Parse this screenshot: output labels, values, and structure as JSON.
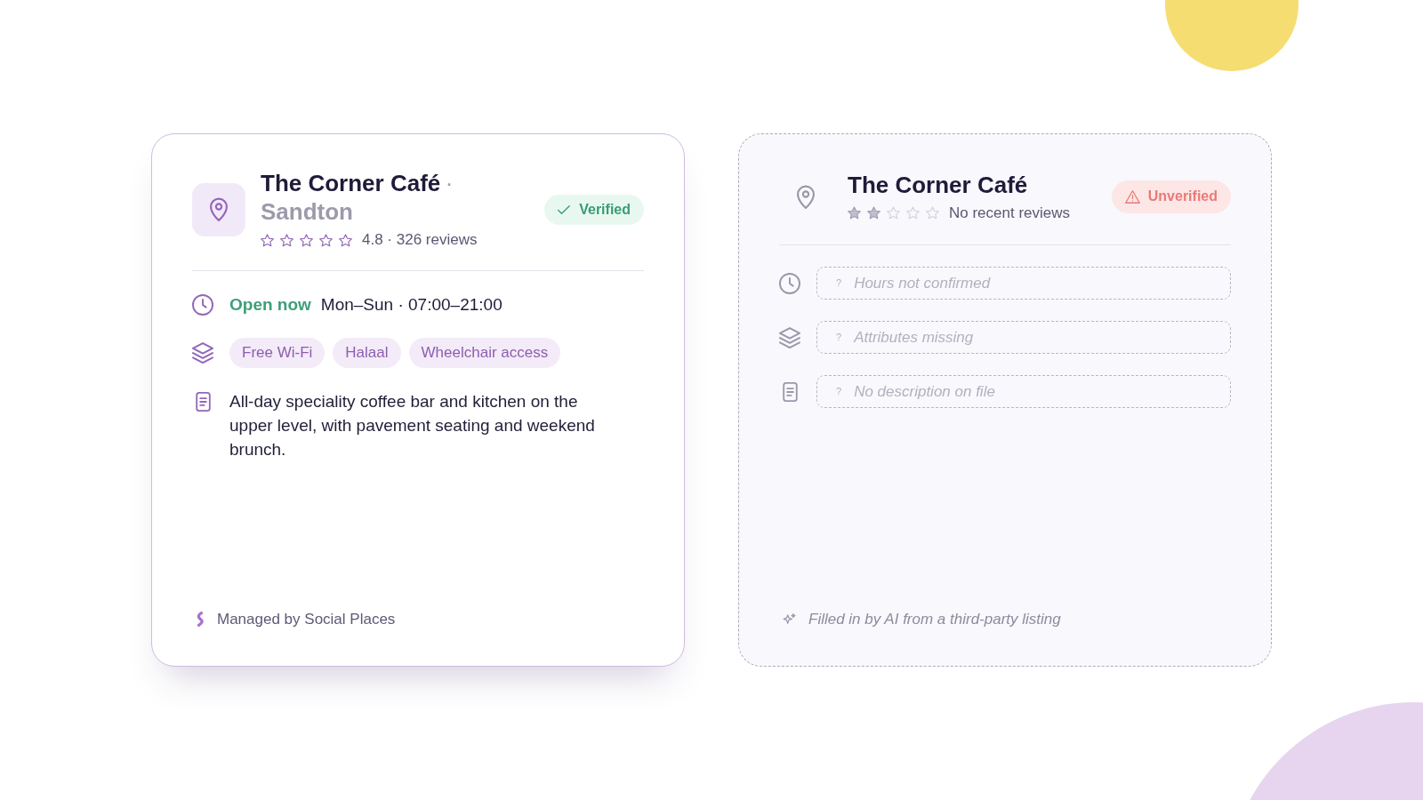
{
  "cards": [
    {
      "kind": "verified",
      "title": "The Corner Café",
      "separator": "·",
      "location": "Sandton",
      "stars": 0,
      "rating_text": "4.8 · 326 reviews",
      "badge": "Verified",
      "rows": [
        {
          "kind": "hours",
          "status": "Open now",
          "schedule": "Mon–Sun · 07:00–21:00"
        },
        {
          "kind": "attributes",
          "tags": [
            "Free Wi-Fi",
            "Halaal",
            "Wheelchair access"
          ]
        },
        {
          "kind": "description",
          "text": "All-day speciality coffee bar and kitchen on the upper level, with pavement seating and weekend brunch."
        }
      ],
      "footer": "Managed by Social Places"
    },
    {
      "kind": "unverified",
      "title": "The Corner Café",
      "stars": 2,
      "rating_text": "No recent reviews",
      "badge": "Unverified",
      "rows": [
        {
          "kind": "missing",
          "marker": "?",
          "text": "Hours not confirmed"
        },
        {
          "kind": "missing",
          "marker": "?",
          "text": "Attributes missing"
        },
        {
          "kind": "missing",
          "marker": "?",
          "text": "No description on file"
        }
      ],
      "footer": "Filled in by AI from a third-party listing"
    }
  ]
}
